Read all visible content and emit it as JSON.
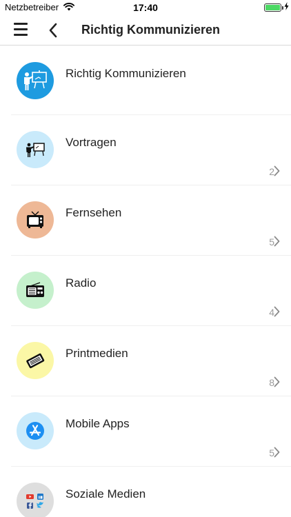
{
  "status_bar": {
    "carrier": "Netzbetreiber",
    "time": "17:40",
    "battery_level": 1.0
  },
  "nav": {
    "title": "Richtig Kommunizieren",
    "menu_icon": "hamburger-menu-icon",
    "back_icon": "chevron-left-icon"
  },
  "list": {
    "header": {
      "title": "Richtig Kommunizieren",
      "icon": "presenter-icon",
      "color": "#1e9be0"
    },
    "items": [
      {
        "title": "Vortragen",
        "count": "2",
        "icon": "presenter-board-icon",
        "color": "#c9eafb"
      },
      {
        "title": "Fernsehen",
        "count": "5",
        "icon": "television-icon",
        "color": "#eeb896"
      },
      {
        "title": "Radio",
        "count": "4",
        "icon": "radio-icon",
        "color": "#c5f0cc"
      },
      {
        "title": "Printmedien",
        "count": "8",
        "icon": "newspaper-icon",
        "color": "#fbf7a6"
      },
      {
        "title": "Mobile Apps",
        "count": "5",
        "icon": "app-store-icon",
        "color": "#c9eafb"
      },
      {
        "title": "Soziale Medien",
        "count": "",
        "icon": "social-media-icon",
        "color": "#dedede"
      }
    ]
  }
}
